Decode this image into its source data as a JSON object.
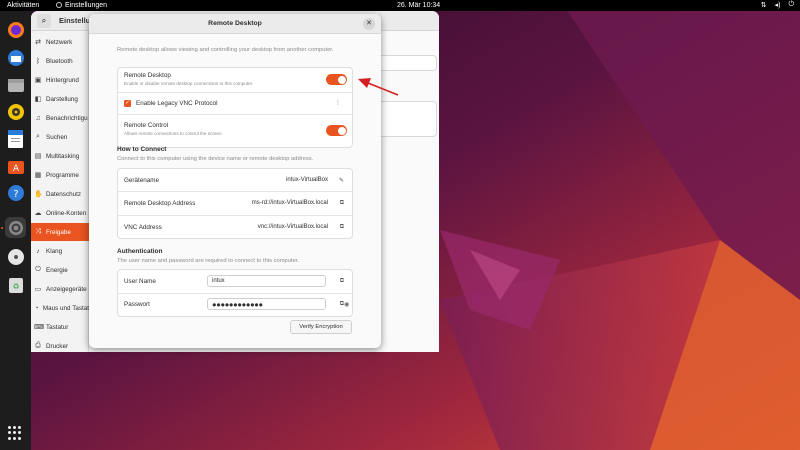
{
  "topbar": {
    "activities": "Aktivitäten",
    "app_name": "Einstellungen",
    "clock": "26. Mär  10:34",
    "tray_icons": [
      "network-icon",
      "volume-icon",
      "power-icon"
    ]
  },
  "dock": {
    "items": [
      "firefox-icon",
      "thunderbird-icon",
      "files-icon",
      "rhythmbox-icon",
      "writer-icon",
      "app-center-icon",
      "help-icon",
      "settings-icon",
      "dvd-icon",
      "trash-icon"
    ],
    "show_apps": "show-apps-icon"
  },
  "settings": {
    "title": "Einstellun",
    "sidebar": [
      {
        "label": "Netzwerk",
        "icon": "network-icon"
      },
      {
        "label": "Bluetooth",
        "icon": "bluetooth-icon"
      },
      {
        "label": "Hintergrund",
        "icon": "background-icon"
      },
      {
        "label": "Darstellung",
        "icon": "appearance-icon"
      },
      {
        "label": "Benachrichtigu",
        "icon": "bell-icon"
      },
      {
        "label": "Suchen",
        "icon": "search-icon"
      },
      {
        "label": "Multitasking",
        "icon": "multitasking-icon"
      },
      {
        "label": "Programme",
        "icon": "apps-icon"
      },
      {
        "label": "Datenschutz",
        "icon": "privacy-icon"
      },
      {
        "label": "Online-Konten",
        "icon": "cloud-icon"
      },
      {
        "label": "Freigabe",
        "icon": "share-icon",
        "selected": true
      },
      {
        "label": "Klang",
        "icon": "sound-icon"
      },
      {
        "label": "Energie",
        "icon": "power-icon"
      },
      {
        "label": "Anzeigegeräte",
        "icon": "display-icon"
      },
      {
        "label": "Maus und Tastat",
        "icon": "mouse-icon"
      },
      {
        "label": "Tastatur",
        "icon": "keyboard-icon"
      },
      {
        "label": "Drucker",
        "icon": "printer-icon"
      }
    ]
  },
  "dialog": {
    "title": "Remote Desktop",
    "description": "Remote desktop allows viewing and controlling your desktop from another computer.",
    "toggles": {
      "remote_desktop": {
        "label": "Remote Desktop",
        "sub": "Enable or disable remote desktop connections to this computer.",
        "on": true
      },
      "legacy_vnc": {
        "label": "Enable Legacy VNC Protocol",
        "checked": true
      },
      "remote_control": {
        "label": "Remote Control",
        "sub": "Allows remote connections to control the screen.",
        "on": true
      }
    },
    "how_to_connect": {
      "heading": "How to Connect",
      "description": "Connect to this computer using the device name or remote desktop address.",
      "rows": [
        {
          "label": "Gerätename",
          "value": "intux-VirtualBox"
        },
        {
          "label": "Remote Desktop Address",
          "value": "ms-rd://intux-VirtualBox.local"
        },
        {
          "label": "VNC Address",
          "value": "vnc://intux-VirtualBox.local"
        }
      ]
    },
    "authentication": {
      "heading": "Authentication",
      "description": "The user name and password are required to connect to this computer.",
      "username_label": "User Name",
      "username_value": "intux",
      "password_label": "Passwort",
      "password_value": "●●●●●●●●●●●●"
    },
    "verify_button": "Verify Encryption"
  },
  "colors": {
    "accent": "#e95420",
    "annotation_arrow": "#d42020"
  }
}
